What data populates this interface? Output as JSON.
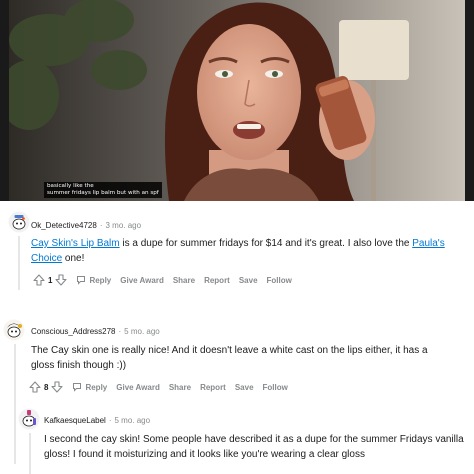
{
  "video": {
    "caption_line1": "basically like the",
    "caption_line2": "summer fridays lip balm but with an spf"
  },
  "comments": [
    {
      "author": "Ok_Detective4728",
      "age": "3 mo. ago",
      "link1": "Cay Skin's Lip Balm",
      "text1": " is a dupe for summer fridays for $14 and it's great. I also love the ",
      "link2": "Paula's Choice",
      "text2": " one!",
      "score": "1",
      "actions": {
        "reply": "Reply",
        "award": "Give Award",
        "share": "Share",
        "report": "Report",
        "save": "Save",
        "follow": "Follow"
      }
    },
    {
      "author": "Conscious_Address278",
      "age": "5 mo. ago",
      "text": "The Cay skin one is really nice! And it doesn't leave a white cast on the lips either, it has a gloss finish though :))",
      "score": "8",
      "actions": {
        "reply": "Reply",
        "award": "Give Award",
        "share": "Share",
        "report": "Report",
        "save": "Save",
        "follow": "Follow"
      }
    },
    {
      "author": "KafkaesqueLabel",
      "age": "5 mo. ago",
      "text": "I second the cay skin! Some people have described it as a dupe for the summer Fridays vanilla gloss! I found it moisturizing and it looks like you're wearing a clear gloss",
      "score": "",
      "actions": {
        "reply": "",
        "award": "",
        "share": "",
        "report": "",
        "save": "",
        "follow": ""
      }
    }
  ],
  "colors": {
    "link": "#0079d3",
    "muted": "#878a8c",
    "text": "#1c1c1c",
    "thread": "#e6e6e6"
  },
  "icons": [
    "upvote-icon",
    "downvote-icon",
    "reply-icon",
    "snoo-avatar-icon"
  ]
}
